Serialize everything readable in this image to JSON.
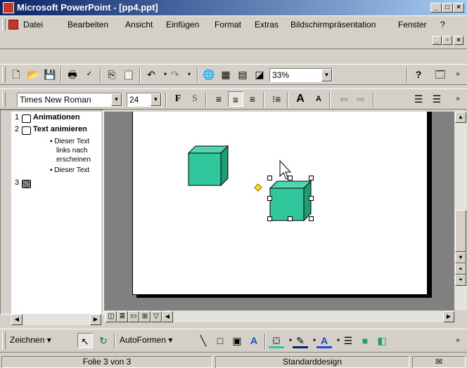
{
  "window": {
    "title": "Microsoft PowerPoint - [pp4.ppt]"
  },
  "menu": {
    "items": [
      "Datei",
      "Bearbeiten",
      "Ansicht",
      "Einfügen",
      "Format",
      "Extras",
      "Bildschirmpräsentation",
      "Fenster",
      "?"
    ]
  },
  "standard_toolbar": {
    "zoom": "33%"
  },
  "format_toolbar": {
    "font": "Times New Roman",
    "size": "24",
    "bold": "F",
    "shadow": "S"
  },
  "outline": {
    "slides": [
      {
        "number": "1",
        "title": "Animationen"
      },
      {
        "number": "2",
        "title": "Text animieren"
      },
      {
        "number": "3",
        "title": ""
      }
    ],
    "bullets": [
      "Dieser Text",
      "links nach",
      "erscheinen",
      "Dieser Text"
    ]
  },
  "drawing_toolbar": {
    "draw_label": "Zeichnen",
    "autoshapes_label": "AutoFormen"
  },
  "status": {
    "slide": "Folie 3 von 3",
    "design": "Standarddesign"
  },
  "colors": {
    "cube": "#2fc79b",
    "title_start": "#0a246a",
    "title_end": "#a6caf0"
  }
}
